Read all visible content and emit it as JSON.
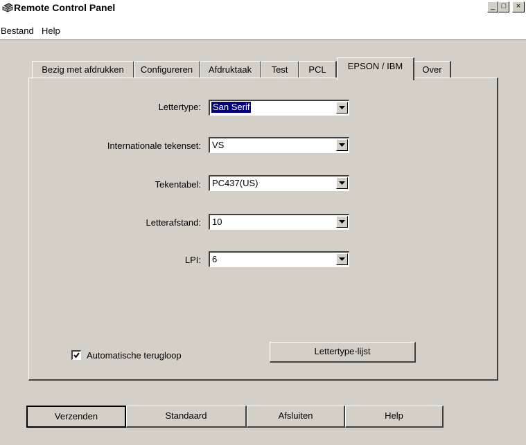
{
  "window": {
    "title": "Remote Control Panel"
  },
  "menu": [
    "Bestand",
    "Help"
  ],
  "tabs": [
    "Bezig met afdrukken",
    "Configureren",
    "Afdruktaak",
    "Test",
    "PCL",
    "EPSON / IBM",
    "Over"
  ],
  "active_tab": "EPSON / IBM",
  "fields": [
    {
      "label": "Lettertype:",
      "value": "San Serif"
    },
    {
      "label": "Internationale tekenset:",
      "value": "VS"
    },
    {
      "label": "Tekentabel:",
      "value": "PC437(US)"
    },
    {
      "label": "Letterafstand:",
      "value": "10"
    },
    {
      "label": "LPI:",
      "value": "6"
    }
  ],
  "checkbox": {
    "label": "Automatische terugloop",
    "checked": true
  },
  "font_list_button": "Lettertype-lijst",
  "bottom_buttons": [
    "Verzenden",
    "Standaard",
    "Afsluiten",
    "Help"
  ],
  "caption_buttons": {
    "minimize": "_",
    "maximize": "□",
    "close": "×"
  }
}
